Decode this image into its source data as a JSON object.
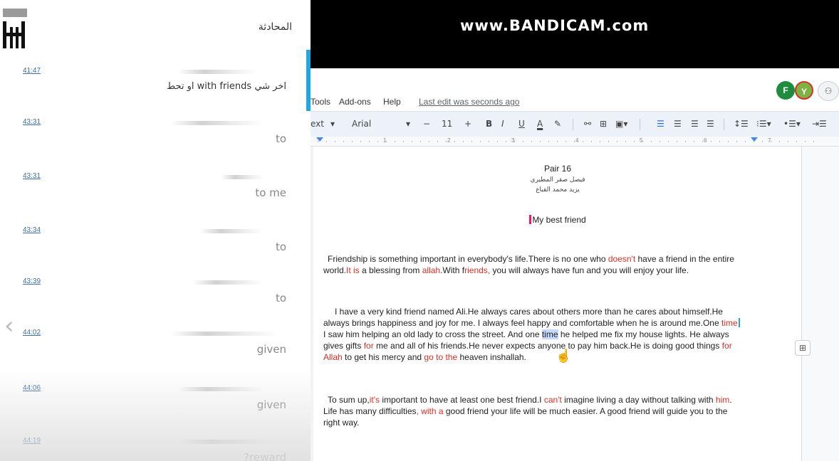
{
  "chat": {
    "title": "المحادثة",
    "back_icon": "arrow-left-icon",
    "logo": "bandicam-logo",
    "messages": [
      {
        "time": "41:47",
        "text": "او تحط with friends اخر شي"
      },
      {
        "time": "43:31",
        "text": "to"
      },
      {
        "time": "43:31",
        "text": "to me"
      },
      {
        "time": "43:34",
        "text": "to"
      },
      {
        "time": "43:39",
        "text": "to"
      },
      {
        "time": "44:02",
        "text": "given"
      },
      {
        "time": "44:06",
        "text": "given"
      },
      {
        "time": "44:19",
        "text": "?reward"
      }
    ]
  },
  "recorder": {
    "watermark": "www.BANDICAM.com"
  },
  "docs": {
    "menu": [
      "Tools",
      "Add-ons",
      "Help"
    ],
    "last_edit": "Last edit was seconds ago",
    "avatars": [
      {
        "letter": "F",
        "color": "#1e8e3e"
      },
      {
        "letter": "Y",
        "color": "#7cb342"
      }
    ],
    "toolbar": {
      "style": "ext",
      "font": "Arial",
      "font_size": "11",
      "minus": "−",
      "plus": "+",
      "bold": "B",
      "italic": "I",
      "underline": "U",
      "text_color": "A"
    },
    "ruler_numbers": [
      "1",
      "2",
      "3",
      "4",
      "5",
      "6",
      "7"
    ],
    "document": {
      "title": "Pair 16",
      "author1": "فيصل صقر المطيري",
      "author2": "يزيد محمد القباع",
      "heading": "My best friend",
      "p1": [
        "Friendship is something important in everybody's life.There is no one who ",
        "doesn't",
        " have a friend in the entire world.",
        "It is",
        " a blessing from ",
        "allah",
        ".With f",
        "riends,",
        " you will always have fun and you will enjoy your life."
      ],
      "p2": [
        "I have a very kind friend named Ali.He always cares about others more than he cares about himself.He always brings happiness and joy for me. I always feel happy and comfortable when he is around me.One ",
        "time",
        " I saw him helping an old lady to cross the street. And one ",
        "time",
        " he helped me fix my house lights. He always gives gifts ",
        "for",
        " me and all of his friends.He never expects anyone to pay him back.He is doing good thin",
        "gs ",
        "for Allah",
        " to get his mercy and ",
        "go to the",
        " heaven inshallah."
      ],
      "p3": [
        "To sum up,",
        "it's",
        " important to have at least one best friend.I ",
        "can't",
        " imagine living a day without talking with ",
        "him",
        ". Life has many difficulties",
        ", with a",
        " good friend your life will be much easier. A good friend will guide you to the right way."
      ]
    }
  }
}
